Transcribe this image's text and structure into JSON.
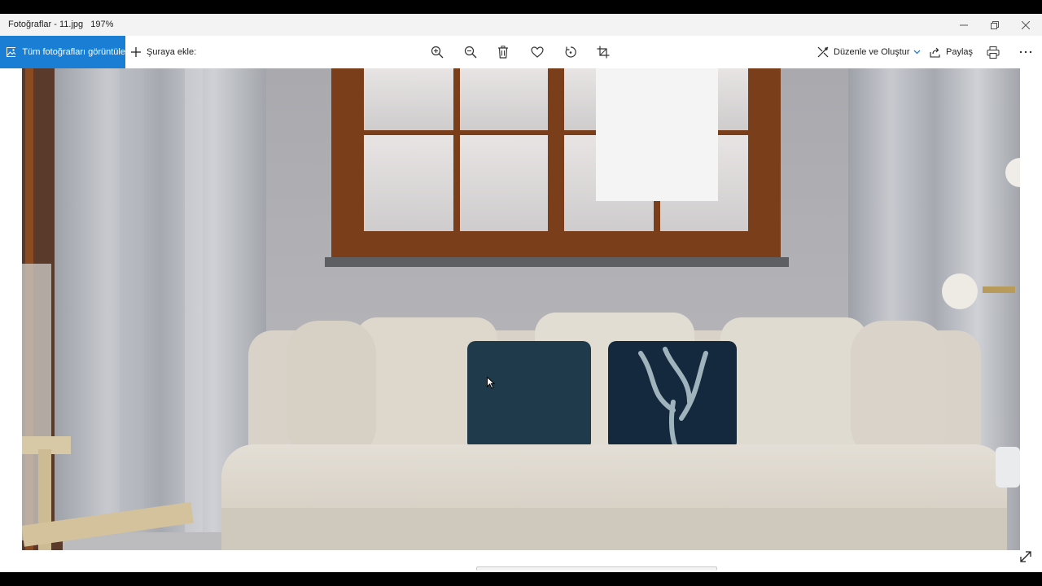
{
  "window": {
    "title": "Fotoğraflar - 11.jpg   197%"
  },
  "toolbar": {
    "all_photos_label": "Tüm fotoğrafları görüntüle",
    "add_to_label": "Şuraya ekle:",
    "edit_create_label": "Düzenle ve Oluştur",
    "share_label": "Paylaş",
    "icons": [
      "zoom-in",
      "zoom-out",
      "delete",
      "favorite",
      "rotate",
      "crop",
      "print",
      "more"
    ]
  },
  "colors": {
    "accent": "#1a7fd4",
    "wall": "#b5b5b9",
    "sofa": "#dcd6cc",
    "navy_pillow": "#1e3a4b",
    "window_frame": "#7a3f1a"
  }
}
